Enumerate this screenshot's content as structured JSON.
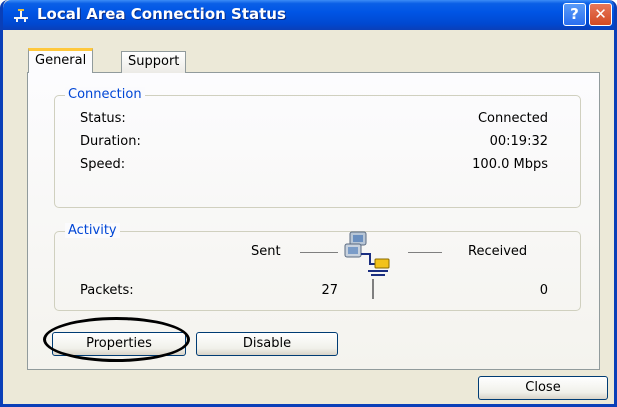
{
  "window": {
    "title": "Local Area Connection Status",
    "help_symbol": "?",
    "close_symbol": "✕"
  },
  "tabs": [
    {
      "label": "General",
      "selected": true
    },
    {
      "label": "Support",
      "selected": false
    }
  ],
  "connection": {
    "legend": "Connection",
    "rows": [
      {
        "label": "Status:",
        "value": "Connected"
      },
      {
        "label": "Duration:",
        "value": "00:19:32"
      },
      {
        "label": "Speed:",
        "value": "100.0 Mbps"
      }
    ]
  },
  "activity": {
    "legend": "Activity",
    "sent_label": "Sent",
    "received_label": "Received",
    "packets_label": "Packets:",
    "packets_sent": "27",
    "packets_received": "0"
  },
  "buttons": {
    "properties": "Properties",
    "disable": "Disable",
    "close": "Close"
  },
  "colors": {
    "titlebar": "#0055e5",
    "legend_text": "#0046d5",
    "selected_tab_accent": "#ffc83c"
  }
}
